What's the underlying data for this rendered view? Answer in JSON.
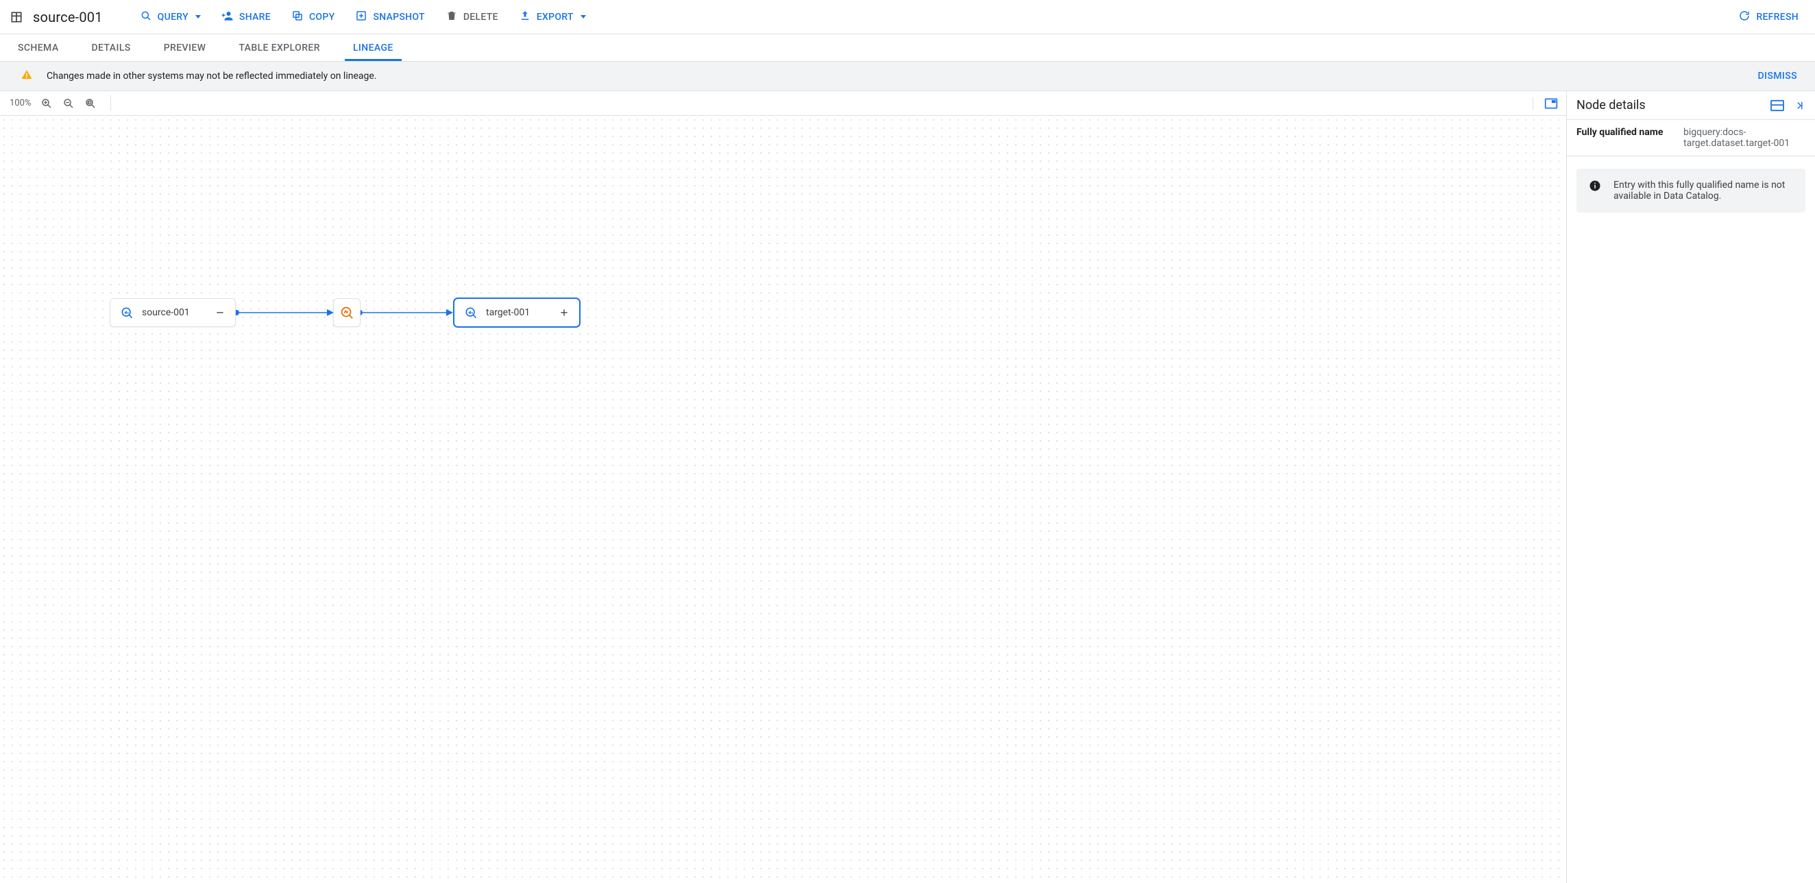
{
  "header": {
    "title": "source-001",
    "actions": {
      "query": "QUERY",
      "share": "SHARE",
      "copy": "COPY",
      "snapshot": "SNAPSHOT",
      "delete": "DELETE",
      "export": "EXPORT",
      "refresh": "REFRESH"
    }
  },
  "tabs": {
    "schema": "SCHEMA",
    "details": "DETAILS",
    "preview": "PREVIEW",
    "table_explorer": "TABLE EXPLORER",
    "lineage": "LINEAGE",
    "active": "lineage"
  },
  "banner": {
    "text": "Changes made in other systems may not be reflected immediately on lineage.",
    "dismiss": "DISMISS"
  },
  "canvas": {
    "zoom": "100%",
    "nodes": {
      "source": {
        "label": "source-001"
      },
      "target": {
        "label": "target-001"
      }
    }
  },
  "side": {
    "title": "Node details",
    "fqn_label": "Fully qualified name",
    "fqn_value": "bigquery:docs-target.dataset.target-001",
    "message": "Entry with this fully qualified name is not available in Data Catalog."
  }
}
